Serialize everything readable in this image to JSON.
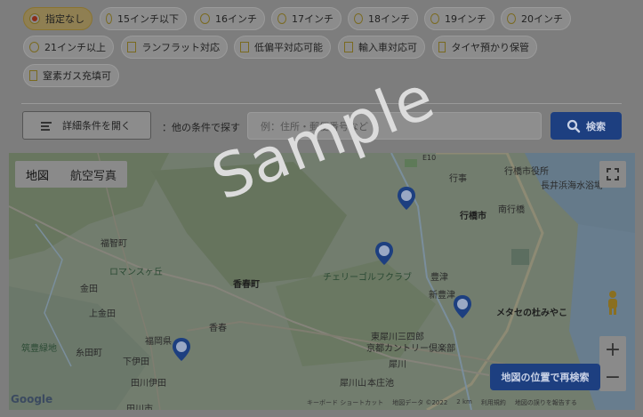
{
  "filters": [
    {
      "label": "指定なし",
      "type": "radio",
      "selected": true
    },
    {
      "label": "15インチ以下",
      "type": "radio",
      "selected": false
    },
    {
      "label": "16インチ",
      "type": "radio",
      "selected": false
    },
    {
      "label": "17インチ",
      "type": "radio",
      "selected": false
    },
    {
      "label": "18インチ",
      "type": "radio",
      "selected": false
    },
    {
      "label": "19インチ",
      "type": "radio",
      "selected": false
    },
    {
      "label": "20インチ",
      "type": "radio",
      "selected": false
    },
    {
      "label": "21インチ以上",
      "type": "radio",
      "selected": false
    },
    {
      "label": "ランフラット対応",
      "type": "checkbox",
      "selected": false
    },
    {
      "label": "低偏平対応可能",
      "type": "checkbox",
      "selected": false
    },
    {
      "label": "輸入車対応可",
      "type": "checkbox",
      "selected": false
    },
    {
      "label": "タイヤ預かり保管",
      "type": "checkbox",
      "selected": false
    },
    {
      "label": "窒素ガス充填可",
      "type": "checkbox",
      "selected": false
    }
  ],
  "search": {
    "detail_button": "詳細条件を開く",
    "other_label": "：他の条件で探す",
    "placeholder": "例：住所・郵便番号など",
    "search_button": "検索"
  },
  "map": {
    "type_options": [
      "地図",
      "航空写真"
    ],
    "selected_type": "地図",
    "research_button": "地図の位置で再検索",
    "logo": "Google",
    "attribution": [
      "キーボード ショートカット",
      "地図データ ©2022",
      "2 km",
      "利用規約",
      "地図の誤りを報告する"
    ],
    "labels": {
      "fukuzumi": "福智町",
      "romansu": "ロマンスヶ丘",
      "kanada": "金田",
      "kamiashiro": "上金田",
      "chikuho": "筑豊緑地",
      "itoda": "糸田町",
      "fukuchi": "福岡県",
      "shimotagawa": "下伊田",
      "tagawa": "田川伊田",
      "tagawa2": "田川市",
      "kasugamachi": "香春町",
      "kawara": "香春",
      "cherry": "チェリーゴルフクラブ",
      "yukuhashi": "行橋市",
      "gyoji": "行事",
      "minamiyukuhashi": "南行橋",
      "yukuhashicityhall": "行橋市役所",
      "nagaihama": "長井浜海水浴場",
      "toyotsu": "豊津",
      "shintoyotsu": "新豊津",
      "mekaso": "メタセの杜みやこ",
      "higashimiyako": "東犀川三四郎",
      "kyotocountry": "京都カントリー倶楽部",
      "saigawa": "犀川",
      "saigawa2": "犀川山",
      "honjo": "本庄池",
      "e10": "E10"
    }
  },
  "watermark": "Sample"
}
